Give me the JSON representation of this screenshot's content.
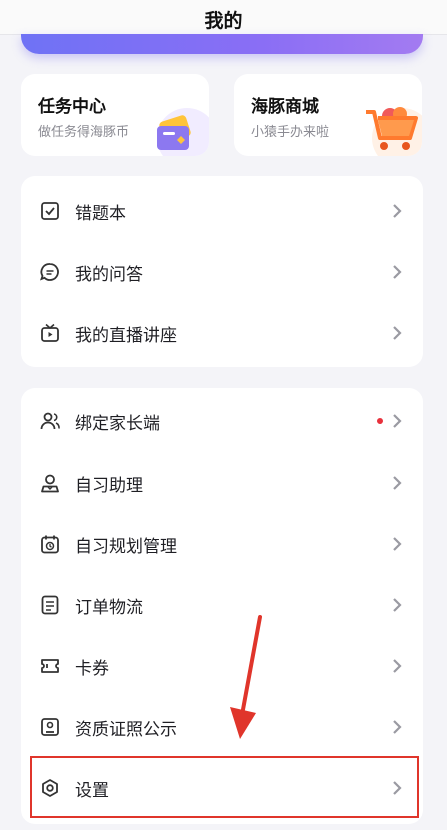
{
  "header": {
    "title": "我的"
  },
  "cards": [
    {
      "title": "任务中心",
      "subtitle": "做任务得海豚币",
      "icon": "task-cards-icon"
    },
    {
      "title": "海豚商城",
      "subtitle": "小猿手办来啦",
      "icon": "shopping-cart-icon"
    }
  ],
  "menu_group_1": [
    {
      "label": "错题本",
      "icon": "checklist-icon"
    },
    {
      "label": "我的问答",
      "icon": "chat-bubble-icon"
    },
    {
      "label": "我的直播讲座",
      "icon": "tv-play-icon"
    }
  ],
  "menu_group_2": [
    {
      "label": "绑定家长端",
      "icon": "users-icon",
      "badge_dot": true
    },
    {
      "label": "自习助理",
      "icon": "assistant-icon"
    },
    {
      "label": "自习规划管理",
      "icon": "calendar-clock-icon"
    },
    {
      "label": "订单物流",
      "icon": "order-list-icon"
    },
    {
      "label": "卡券",
      "icon": "ticket-icon"
    },
    {
      "label": "资质证照公示",
      "icon": "certificate-icon"
    },
    {
      "label": "设置",
      "icon": "settings-icon"
    }
  ],
  "colors": {
    "accent": "#7b6ff3",
    "badge": "#e8313c",
    "highlight": "#e0352b"
  }
}
